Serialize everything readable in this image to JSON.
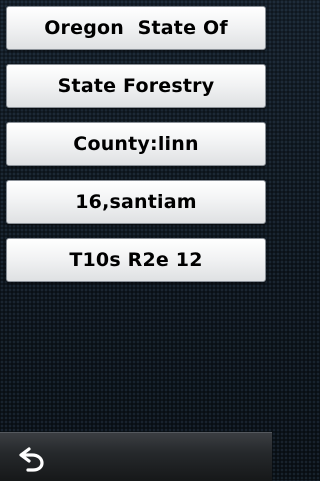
{
  "items": [
    {
      "label": "Oregon  State Of"
    },
    {
      "label": "State Forestry"
    },
    {
      "label": "County:linn"
    },
    {
      "label": "16,santiam"
    },
    {
      "label": "T10s R2e 12"
    }
  ],
  "bottom_bar": {
    "back_icon": "back-arrow-icon"
  },
  "colors": {
    "button_face": "#f2f3f4",
    "background": "#101820",
    "bar": "#26292c"
  }
}
